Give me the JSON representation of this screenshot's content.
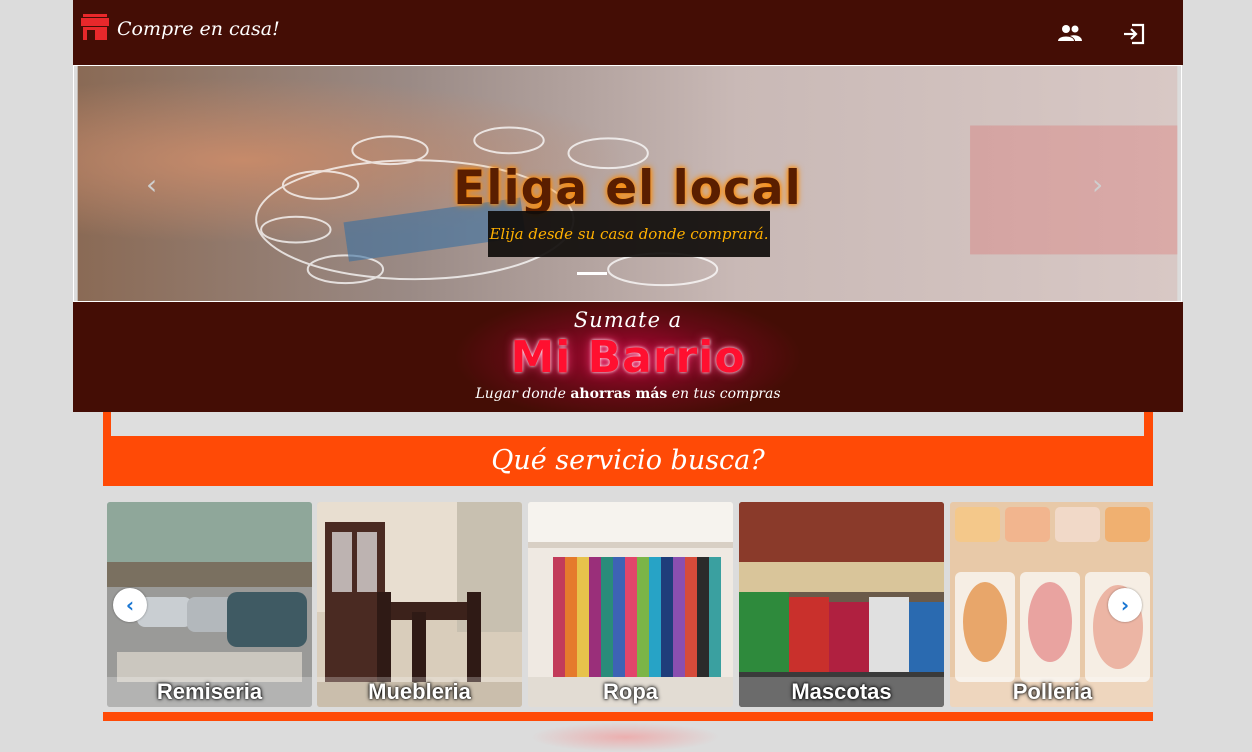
{
  "navbar": {
    "brand_label": "Compre en casa!",
    "brand_icon": "store-icon",
    "users_icon": "users-icon",
    "login_icon": "login-icon"
  },
  "hero": {
    "title": "Eliga el local",
    "subtitle": "Elija desde su casa donde comprará.",
    "prev_arrow": "‹",
    "next_arrow": "›"
  },
  "banner": {
    "top": "Sumate a",
    "title": "Mi Barrio",
    "sub_before": "Lugar donde",
    "sub_bold": "ahorras más",
    "sub_after": "en tus compras"
  },
  "section": {
    "title": "Qué servicio busca?"
  },
  "services": {
    "items": [
      {
        "label": "Remiseria"
      },
      {
        "label": "Muebleria"
      },
      {
        "label": "Ropa"
      },
      {
        "label": "Mascotas"
      },
      {
        "label": "Polleria"
      }
    ],
    "prev": "‹",
    "next": "›"
  },
  "colors": {
    "navbar": "#440d05",
    "accent": "#ff4a06",
    "page": "#dcdcdc"
  }
}
